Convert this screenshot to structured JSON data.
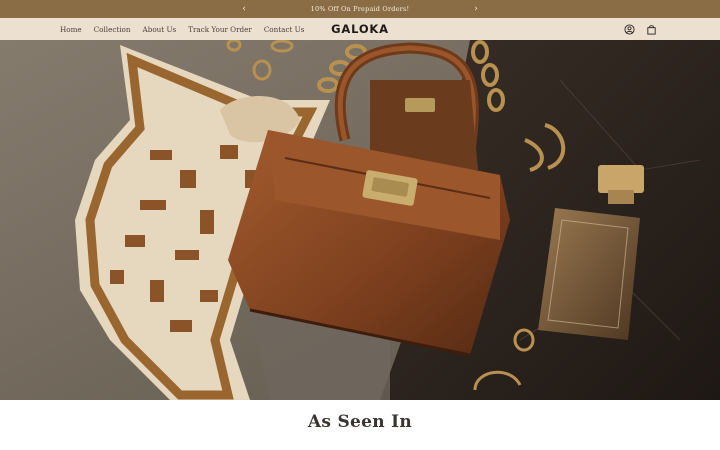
{
  "announcement": {
    "text": "10% Off On Prepaid Orders!",
    "prev_icon": "chevron-left-icon",
    "next_icon": "chevron-right-icon",
    "prev_glyph": "‹",
    "next_glyph": "›"
  },
  "header": {
    "nav": [
      "Home",
      "Collection",
      "About Us",
      "Track Your Order",
      "Contact Us"
    ],
    "logo": "GALOKA",
    "icons": [
      "account-icon",
      "cart-icon"
    ]
  },
  "hero": {
    "alt_subject": "handbag-scarf-jewelry-perfume",
    "colors": {
      "left_bg": "#7d7466",
      "right_bg": "#2a221d",
      "bag": "#8b4a24",
      "gold": "#b48a4a",
      "scarf_light": "#e9dcc6",
      "scarf_brown": "#8a5a2b"
    }
  },
  "section": {
    "title": "As Seen In"
  },
  "theme": {
    "announce_bg": "#8a6d44",
    "header_bg": "#ece1d1"
  }
}
